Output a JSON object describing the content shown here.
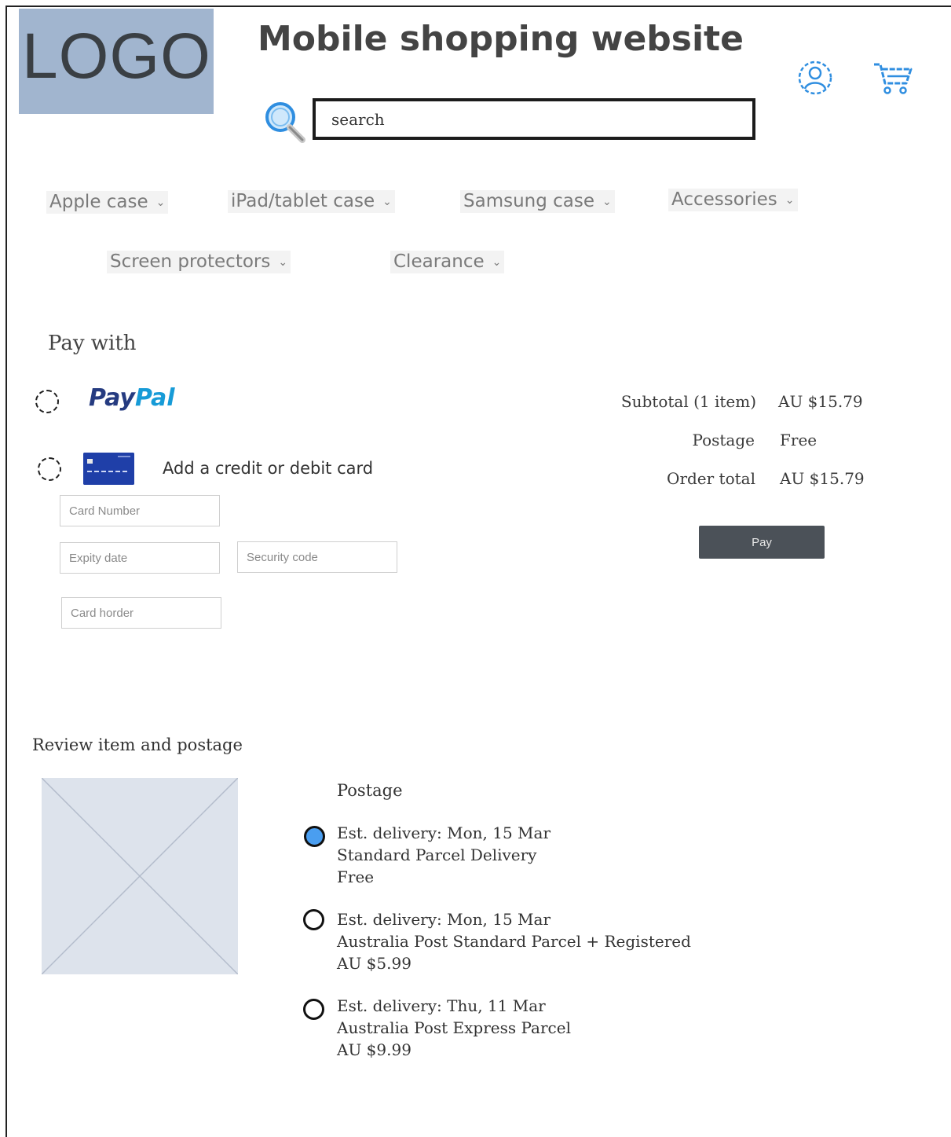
{
  "header": {
    "logo": "LOGO",
    "title": "Mobile shopping website",
    "search_placeholder": "search",
    "icons": [
      "search-icon",
      "user-icon",
      "cart-icon"
    ]
  },
  "nav": [
    {
      "label": "Apple case"
    },
    {
      "label": "iPad/tablet case"
    },
    {
      "label": "Samsung case"
    },
    {
      "label": "Accessories"
    },
    {
      "label": "Screen protectors"
    },
    {
      "label": "Clearance"
    }
  ],
  "payment": {
    "heading": "Pay with",
    "paypal_part1": "Pay",
    "paypal_part2": "Pal",
    "card_option": "Add a credit or debit card",
    "fields": {
      "card_number": "Card Number",
      "expiry": "Expity date",
      "security": "Security code",
      "holder": "Card horder"
    }
  },
  "summary": {
    "subtotal_label": "Subtotal (1 item)",
    "subtotal_value": "AU $15.79",
    "postage_label": "Postage",
    "postage_value": "Free",
    "total_label": "Order total",
    "total_value": "AU $15.79",
    "pay_button": "Pay"
  },
  "review": {
    "heading": "Review item and postage",
    "postage_heading": "Postage",
    "options": [
      {
        "delivery": "Est. delivery: Mon, 15 Mar",
        "service": "Standard Parcel Delivery",
        "price": "Free",
        "selected": true
      },
      {
        "delivery": "Est. delivery: Mon, 15 Mar",
        "service": "Australia Post Standard Parcel + Registered",
        "price": "AU $5.99",
        "selected": false
      },
      {
        "delivery": "Est. delivery: Thu, 11 Mar",
        "service": "Australia Post Express Parcel",
        "price": "AU $9.99",
        "selected": false
      }
    ]
  },
  "colors": {
    "logo_bg": "#a1b5cf",
    "accent": "#4a9ef0",
    "pay_button": "#4b5158",
    "paypal_dark": "#253b80",
    "paypal_light": "#179bd7",
    "card": "#1f3fa8"
  }
}
